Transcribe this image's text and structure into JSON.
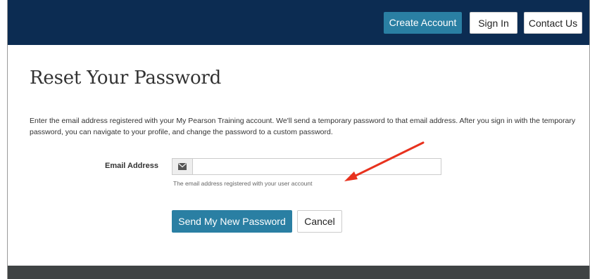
{
  "header": {
    "create_account": "Create Account",
    "sign_in": "Sign In",
    "contact_us": "Contact Us"
  },
  "main": {
    "title": "Reset Your Password",
    "intro": "Enter the email address registered with your My Pearson Training account. We'll send a temporary password to that email address. After you sign in with the temporary password, you can navigate to your profile, and change the password to a custom password.",
    "email_label": "Email Address",
    "email_value": "",
    "email_help": "The email address registered with your user account",
    "send_button": "Send My New Password",
    "cancel_button": "Cancel"
  },
  "icons": {
    "email_addon": "envelope-icon",
    "annotation": "red-arrow"
  },
  "colors": {
    "header_bg": "#0c2c52",
    "primary": "#2a7fa3",
    "footer_bg": "#3f4344",
    "annotation": "#e8321e"
  }
}
